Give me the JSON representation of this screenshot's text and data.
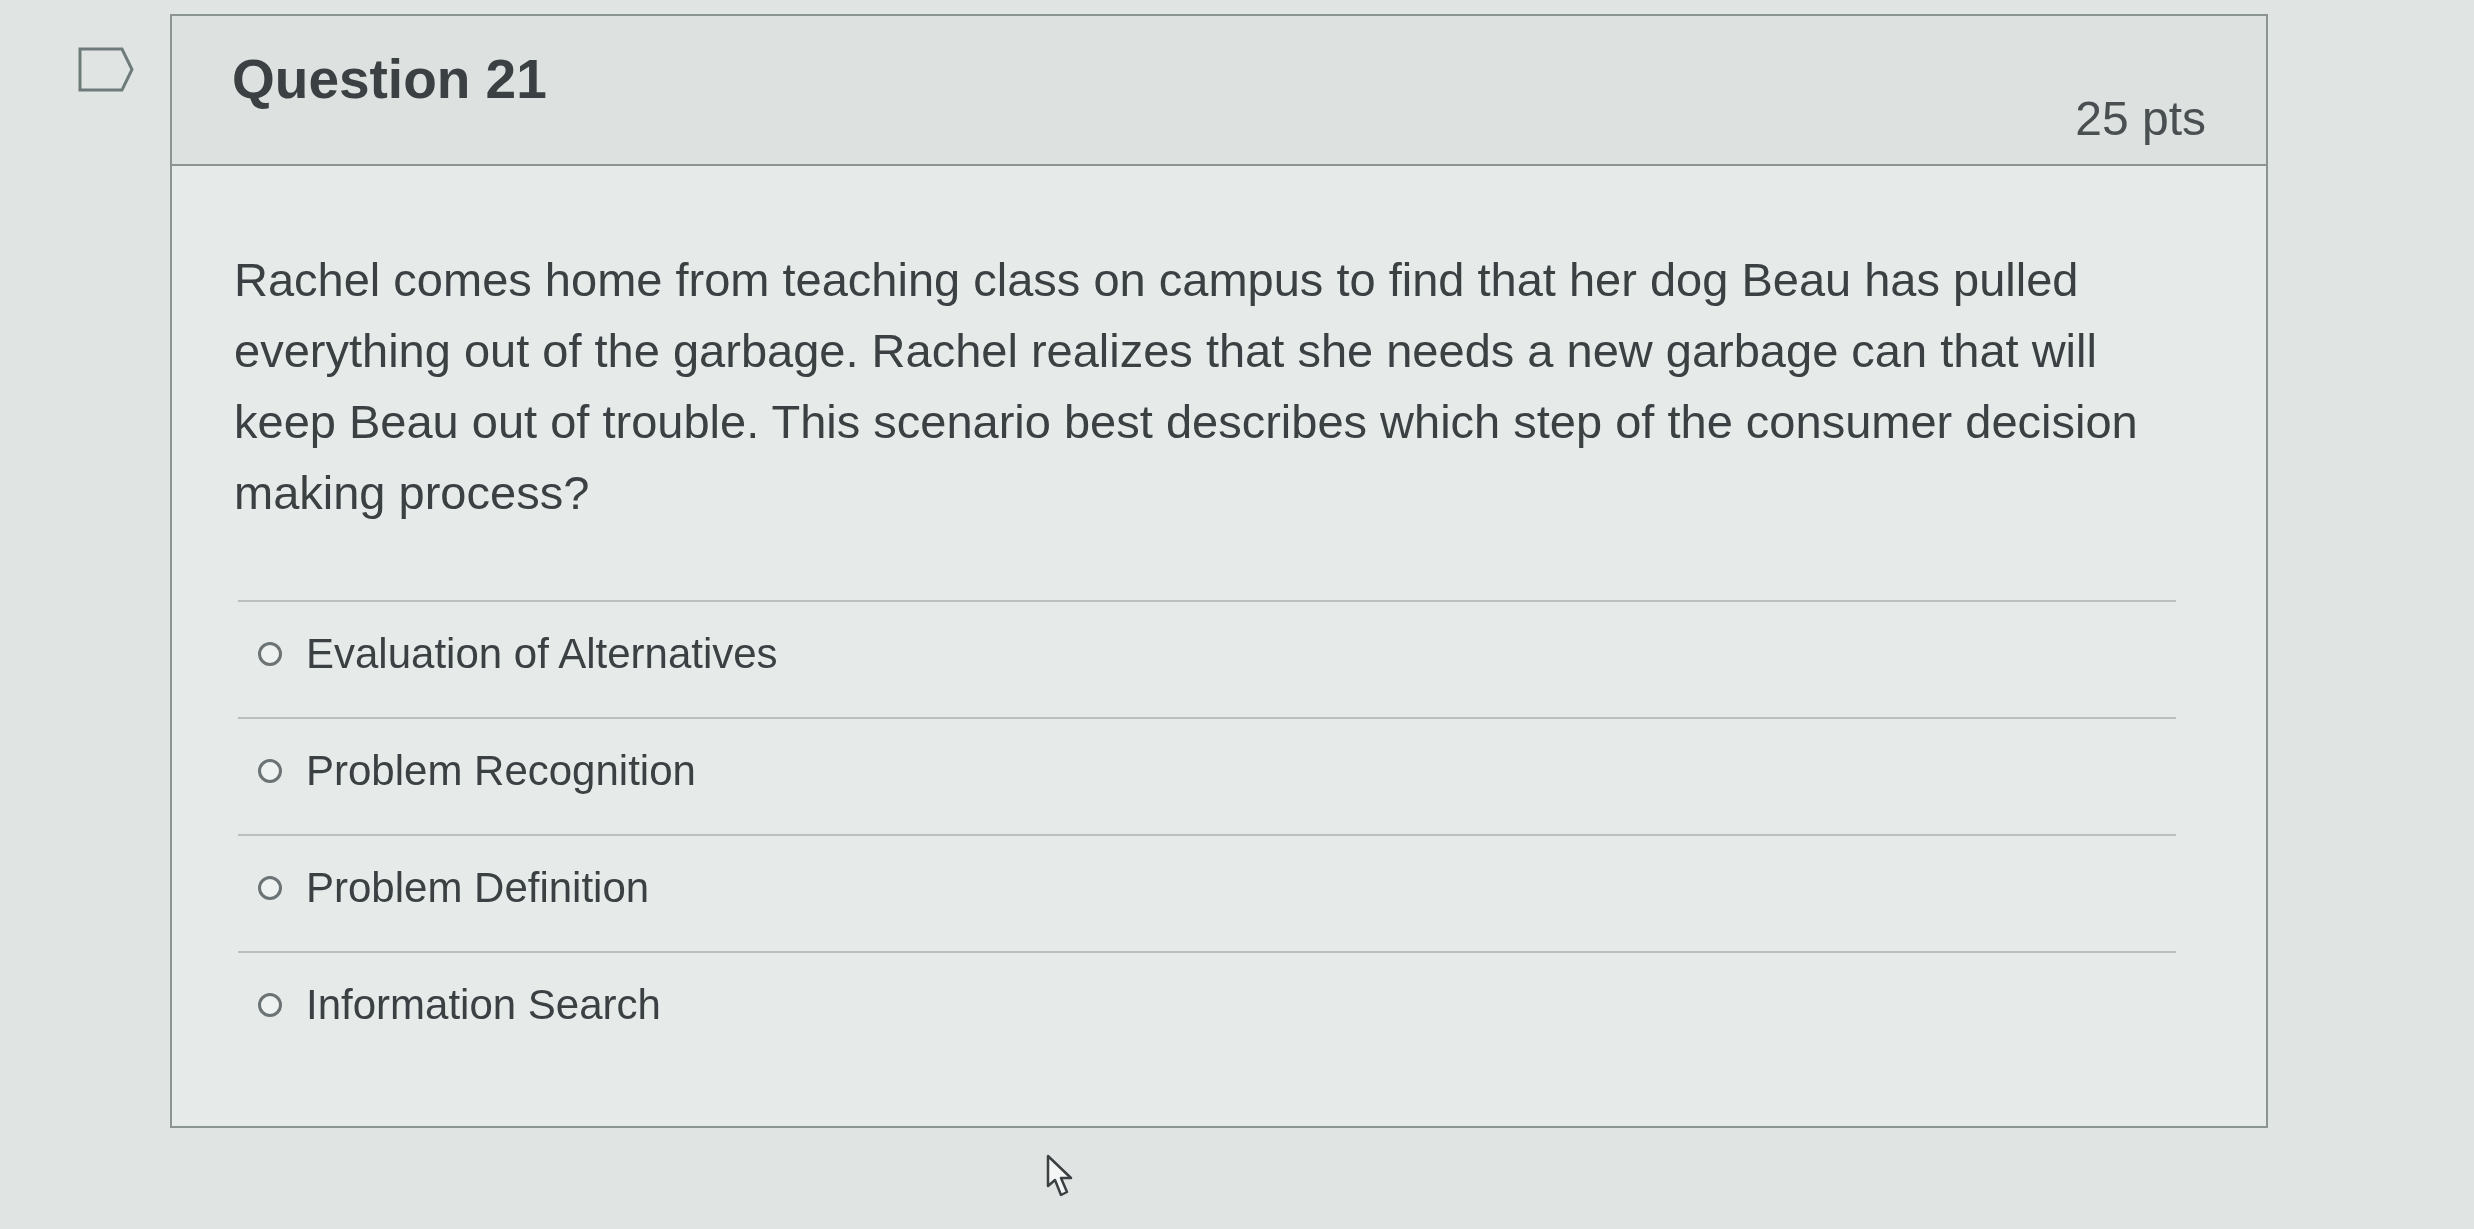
{
  "question": {
    "title": "Question 21",
    "points": "25 pts",
    "text": "Rachel comes home from teaching class on campus to find that her dog Beau has pulled everything out of the garbage. Rachel realizes that she needs a new garbage can that will keep Beau out of trouble. This scenario best describes which step of the consumer decision making process?",
    "options": [
      {
        "label": "Evaluation of Alternatives",
        "selected": false
      },
      {
        "label": "Problem Recognition",
        "selected": false
      },
      {
        "label": "Problem Definition",
        "selected": false
      },
      {
        "label": "Information Search",
        "selected": false
      }
    ]
  }
}
